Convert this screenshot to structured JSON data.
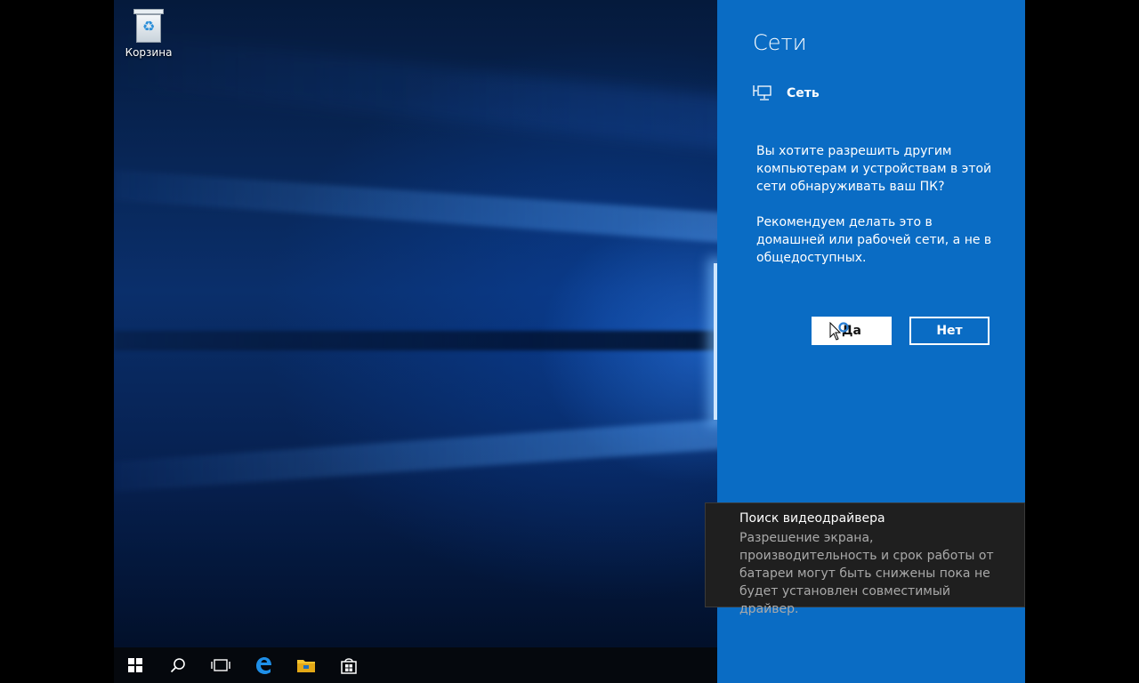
{
  "desktop": {
    "recycle_bin_label": "Корзина"
  },
  "taskbar": {
    "items": [
      {
        "name": "start",
        "icon": "windows-logo-icon"
      },
      {
        "name": "search",
        "icon": "search-icon"
      },
      {
        "name": "task-view",
        "icon": "task-view-icon"
      },
      {
        "name": "edge",
        "icon": "edge-browser-icon"
      },
      {
        "name": "file-explorer",
        "icon": "folder-icon"
      },
      {
        "name": "store",
        "icon": "store-bag-icon"
      }
    ]
  },
  "network_panel": {
    "title": "Сети",
    "network_name": "Сеть",
    "network_icon": "wired-network-icon",
    "question_text": "Вы хотите разрешить другим компьютерам и устройствам в этой сети обнаруживать ваш ПК?",
    "recommendation_text": "Рекомендуем делать это в домашней или рабочей сети, а не в общедоступных.",
    "yes_label": "Да",
    "no_label": "Нет",
    "accent_color": "#0a6cc4"
  },
  "notification": {
    "title": "Поиск видеодрайвера",
    "body": "Разрешение экрана, производительность и срок работы от батареи могут быть снижены пока не будет установлен совместимый драйвер."
  }
}
